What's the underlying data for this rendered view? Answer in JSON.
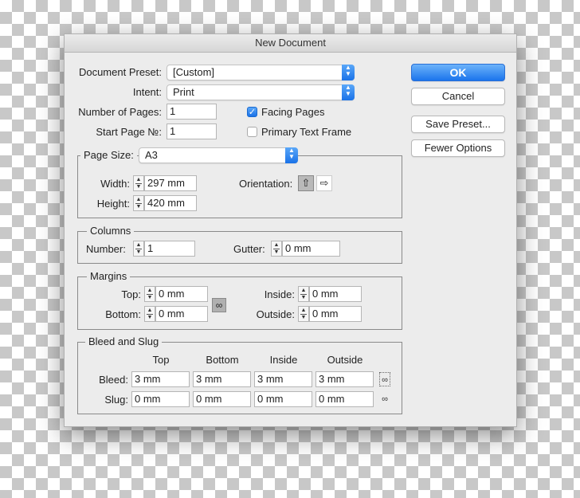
{
  "window": {
    "title": "New Document"
  },
  "general": {
    "document_preset_label": "Document Preset:",
    "document_preset_value": "[Custom]",
    "intent_label": "Intent:",
    "intent_value": "Print",
    "num_pages_label": "Number of Pages:",
    "num_pages_value": "1",
    "start_page_label": "Start Page №:",
    "start_page_value": "1",
    "facing_pages_label": "Facing Pages",
    "facing_pages_checked": true,
    "primary_text_frame_label": "Primary Text Frame",
    "primary_text_frame_checked": false
  },
  "buttons": {
    "ok": "OK",
    "cancel": "Cancel",
    "save_preset": "Save Preset...",
    "fewer_options": "Fewer Options"
  },
  "page_size": {
    "label": "Page Size:",
    "value": "A3",
    "width_label": "Width:",
    "width_value": "297 mm",
    "height_label": "Height:",
    "height_value": "420 mm",
    "orientation_label": "Orientation:",
    "orientation_selected": "portrait",
    "portrait_icon": "portrait-page-icon",
    "landscape_icon": "landscape-page-icon"
  },
  "columns": {
    "legend": "Columns",
    "number_label": "Number:",
    "number_value": "1",
    "gutter_label": "Gutter:",
    "gutter_value": "0 mm"
  },
  "margins": {
    "legend": "Margins",
    "top_label": "Top:",
    "top_value": "0 mm",
    "bottom_label": "Bottom:",
    "bottom_value": "0 mm",
    "inside_label": "Inside:",
    "inside_value": "0 mm",
    "outside_label": "Outside:",
    "outside_value": "0 mm",
    "link_icon": "chain-link-icon"
  },
  "bleed_slug": {
    "legend": "Bleed and Slug",
    "columns": [
      "Top",
      "Bottom",
      "Inside",
      "Outside"
    ],
    "bleed_label": "Bleed:",
    "bleed_values": [
      "3 mm",
      "3 mm",
      "3 mm",
      "3 mm"
    ],
    "slug_label": "Slug:",
    "slug_values": [
      "0 mm",
      "0 mm",
      "0 mm",
      "0 mm"
    ]
  },
  "colors": {
    "accent": "#1a72e8",
    "dialog_bg": "#ececec"
  }
}
